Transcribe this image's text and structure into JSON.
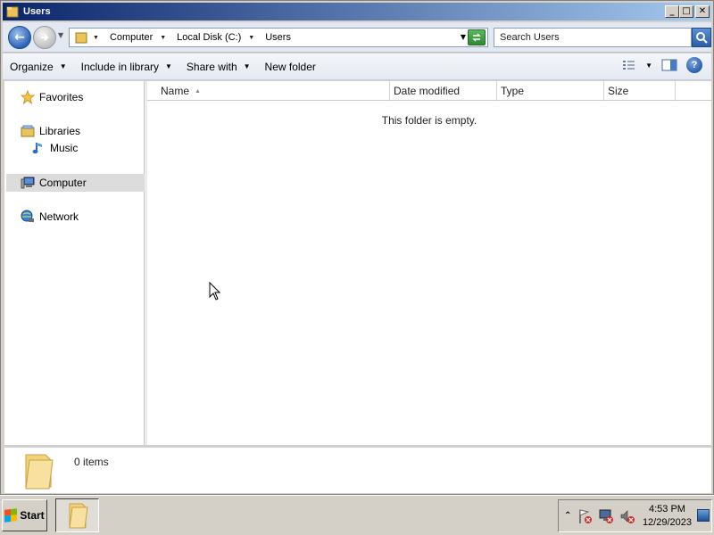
{
  "window": {
    "title": "Users",
    "minimize_glyph": "_",
    "maximize_glyph": "□",
    "close_glyph": "✕"
  },
  "address": {
    "back_glyph": "←",
    "breadcrumbs": [
      "Computer",
      "Local Disk (C:)",
      "Users"
    ],
    "search_placeholder": "Search Users"
  },
  "toolbar": {
    "organize": "Organize",
    "include_in_library": "Include in library",
    "share_with": "Share with",
    "new_folder": "New folder",
    "help_glyph": "?"
  },
  "navpane": {
    "favorites": "Favorites",
    "libraries": "Libraries",
    "music": "Music",
    "computer": "Computer",
    "network": "Network"
  },
  "columns": {
    "name": "Name",
    "date_modified": "Date modified",
    "type": "Type",
    "size": "Size"
  },
  "content": {
    "empty_message": "This folder is empty."
  },
  "details": {
    "item_count": "0 items"
  },
  "taskbar": {
    "start": "Start",
    "tray_up_glyph": "⌃",
    "time": "4:53 PM",
    "date": "12/29/2023"
  },
  "colors": {
    "title_gradient_start": "#0a246a",
    "title_gradient_end": "#a6caf0",
    "chrome": "#d4d0c8",
    "selection": "#dcdcdc"
  }
}
